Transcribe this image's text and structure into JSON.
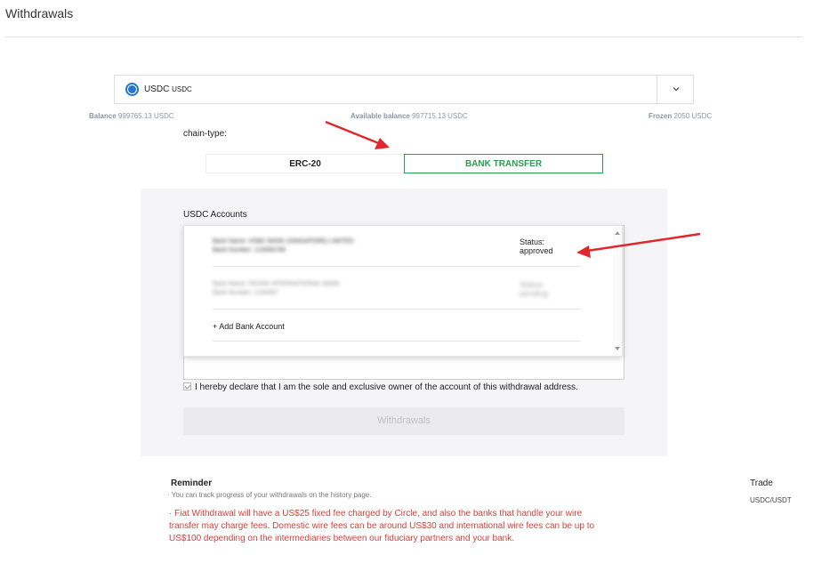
{
  "header": {
    "title": "Withdrawals"
  },
  "coin_select": {
    "name": "USDC",
    "symbol": "USDC"
  },
  "balances": {
    "balance_label": "Balance",
    "balance_value": "999765.13 USDC",
    "available_label": "Available balance",
    "available_value": "997715.13 USDC",
    "frozen_label": "Frozen",
    "frozen_value": "2050 USDC"
  },
  "chain": {
    "label": "chain-type:",
    "tabs": [
      {
        "label": "ERC-20",
        "active": false
      },
      {
        "label": "BANK TRANSFER",
        "active": true
      }
    ]
  },
  "accounts": {
    "label": "USDC Accounts",
    "items": [
      {
        "bank_name": "Bank Name: HSBC BANK (SINGAPORE) LIMITED",
        "bank_number": "Bank Number: 123456789",
        "status_label": "Status:",
        "status_value": "approved"
      },
      {
        "bank_name": "Bank Name: FAZAIK INTERNATIONAL BANK",
        "bank_number": "Bank Number: 1234567",
        "status_label": "Status:",
        "status_value": "pending"
      }
    ],
    "add_label": "+ Add Bank Account"
  },
  "declaration": "I hereby declare that I am the sole and exclusive owner of the account of this withdrawal address.",
  "submit_label": "Withdrawals",
  "reminder": {
    "title": "Reminder",
    "note": "· You can track progress of your withdrawals on the history page.",
    "fiat_note": "· Fiat Withdrawal will have a US$25 fixed fee charged by Circle, and also the banks that handle your wire transfer may charge fees. Domestic wire fees can be around US$30 and international wire fees can be up to US$100 depending on the intermediaries between our fiduciary partners and your bank."
  },
  "trade": {
    "title": "Trade",
    "pair": "USDC/USDT"
  },
  "colors": {
    "accent_green": "#2a9d4f",
    "warning_red": "#e23b3b",
    "usdc_blue": "#2775ca",
    "annotation_red": "#e0282c"
  }
}
